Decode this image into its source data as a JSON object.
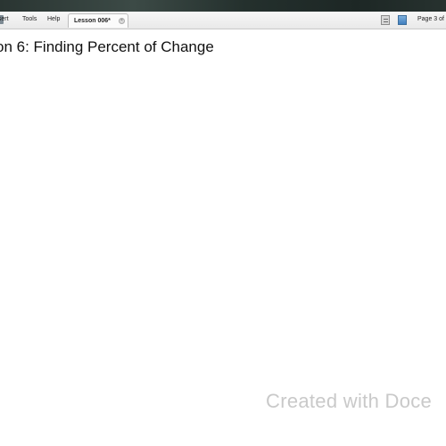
{
  "menubar": {
    "items": [
      "nsert",
      "Tools",
      "Help"
    ]
  },
  "tab": {
    "label": "Lesson 006*",
    "close_symbol": "×"
  },
  "toolbar": {
    "page_indicator": "Page 3 of",
    "icons": [
      "page-view-icon",
      "slide-view-icon"
    ]
  },
  "document": {
    "title": "on 6: Finding Percent of Change"
  },
  "watermark": {
    "text": "Created with Doce"
  },
  "colors": {
    "top_strip": "#2a3532",
    "menubar_bg": "#efefef",
    "watermark": "#c9c9c9"
  }
}
